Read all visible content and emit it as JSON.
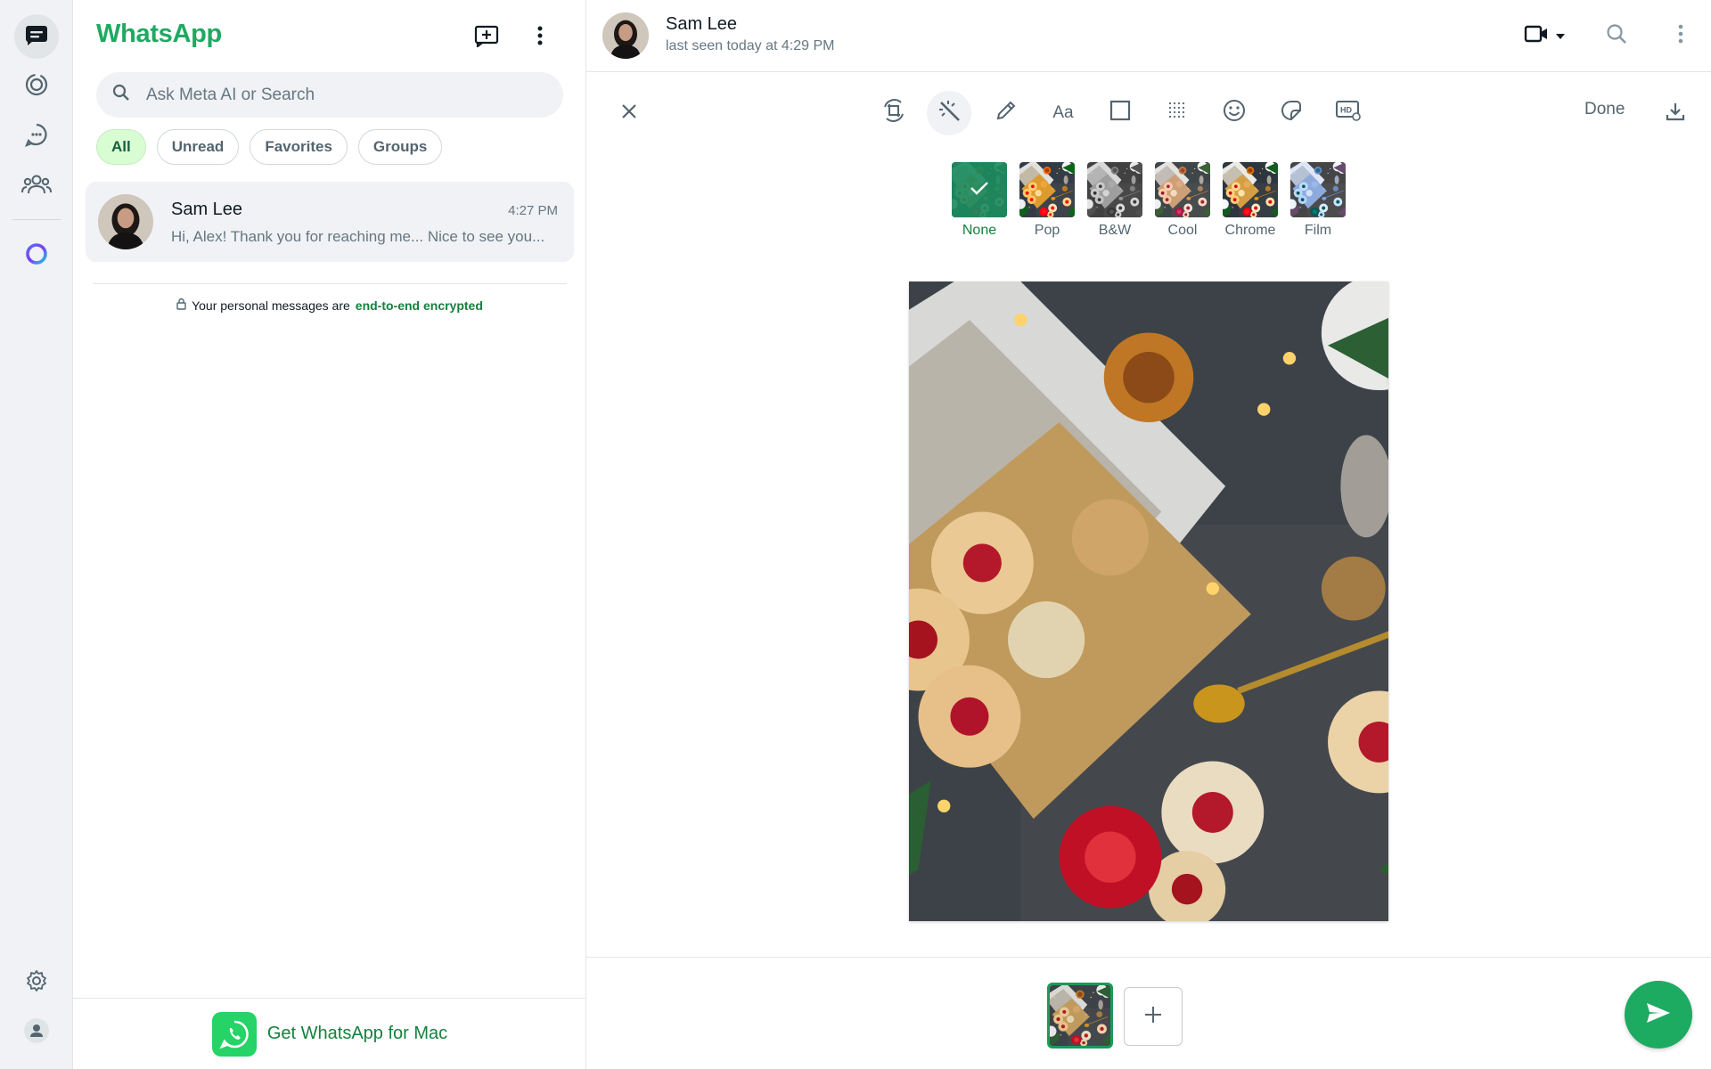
{
  "app": {
    "title": "WhatsApp"
  },
  "nav": {
    "items": [
      {
        "icon": "chats-icon",
        "active": true
      },
      {
        "icon": "status-icon",
        "active": false
      },
      {
        "icon": "channels-icon",
        "active": false
      },
      {
        "icon": "communities-icon",
        "active": false
      },
      {
        "icon": "meta-ai-icon",
        "active": false
      }
    ],
    "bottom": [
      {
        "icon": "settings-icon"
      },
      {
        "icon": "profile-icon"
      }
    ]
  },
  "chat_list": {
    "search": {
      "placeholder": "Ask Meta AI or Search",
      "value": ""
    },
    "chips": [
      {
        "label": "All",
        "active": true
      },
      {
        "label": "Unread",
        "active": false
      },
      {
        "label": "Favorites",
        "active": false
      },
      {
        "label": "Groups",
        "active": false
      }
    ],
    "chats": [
      {
        "name": "Sam Lee",
        "time": "4:27 PM",
        "preview": "Hi, Alex! Thank you for reaching me... Nice to see you..."
      }
    ],
    "encryption": {
      "text": "Your personal messages are",
      "link": "end-to-end encrypted"
    },
    "footer": {
      "label": "Get WhatsApp for Mac"
    }
  },
  "conversation": {
    "contact": {
      "name": "Sam Lee",
      "status": "last seen today at 4:29 PM"
    },
    "editor": {
      "tools": [
        {
          "icon": "crop-rotate-icon",
          "active": false
        },
        {
          "icon": "magic-wand-icon",
          "active": true
        },
        {
          "icon": "pencil-icon",
          "active": false
        },
        {
          "icon": "text-icon",
          "label": "Aa",
          "active": false
        },
        {
          "icon": "square-shape-icon",
          "active": false
        },
        {
          "icon": "blur-grid-icon",
          "active": false
        },
        {
          "icon": "emoji-icon",
          "active": false
        },
        {
          "icon": "sticker-icon",
          "active": false
        },
        {
          "icon": "hd-settings-icon",
          "active": false
        }
      ],
      "done_label": "Done",
      "filters": [
        {
          "label": "None",
          "selected": true
        },
        {
          "label": "Pop",
          "selected": false
        },
        {
          "label": "B&W",
          "selected": false
        },
        {
          "label": "Cool",
          "selected": false
        },
        {
          "label": "Chrome",
          "selected": false
        },
        {
          "label": "Film",
          "selected": false
        }
      ]
    }
  },
  "colors": {
    "accent": "#1daa61",
    "link": "#15803d",
    "chip_active_bg": "#d9fdd3",
    "panel_bg": "#f0f2f5"
  }
}
